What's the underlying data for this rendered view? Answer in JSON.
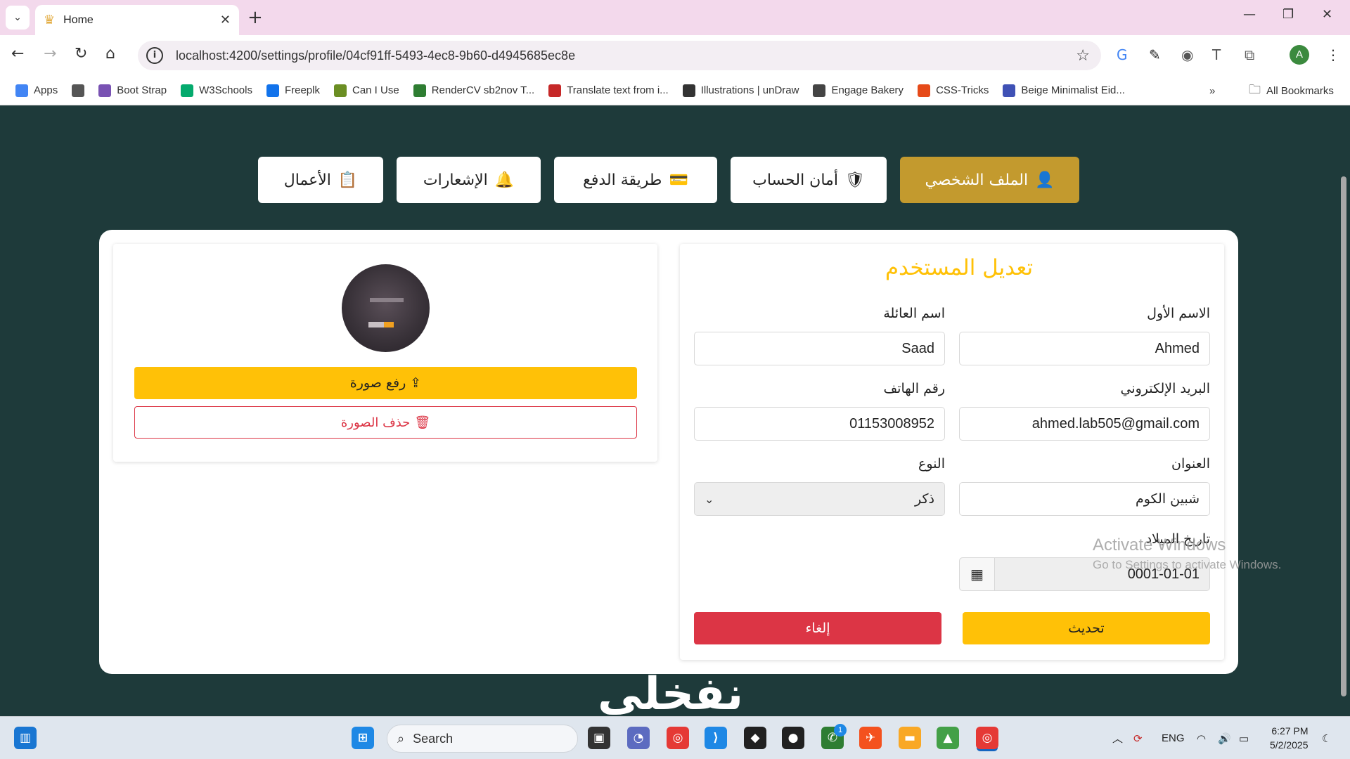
{
  "browser": {
    "tab_title": "Home",
    "url": "localhost:4200/settings/profile/04cf91ff-5493-4ec8-9b60-d4945685ec8e",
    "bookmarks": [
      {
        "label": "Apps",
        "icon": "apps-grid-icon",
        "color": "#4285f4"
      },
      {
        "label": "",
        "icon": "tab-groups-icon",
        "color": "#555555"
      },
      {
        "label": "Boot Strap",
        "icon": "bootstrap-icon",
        "color": "#7952b3"
      },
      {
        "label": "W3Schools",
        "icon": "w3schools-icon",
        "color": "#04aa6d"
      },
      {
        "label": "Freeplk",
        "icon": "freepik-icon",
        "color": "#1273eb"
      },
      {
        "label": "Can I Use",
        "icon": "caniuse-icon",
        "color": "#6b8e23"
      },
      {
        "label": "RenderCV sb2nov T...",
        "icon": "rendercv-icon",
        "color": "#2e7d32"
      },
      {
        "label": "Translate text from i...",
        "icon": "translate-icon",
        "color": "#c62828"
      },
      {
        "label": "Illustrations | unDraw",
        "icon": "undraw-icon",
        "color": "#333333"
      },
      {
        "label": "Engage Bakery",
        "icon": "globe-icon",
        "color": "#444444"
      },
      {
        "label": "CSS-Tricks",
        "icon": "csstricks-icon",
        "color": "#e64a19"
      },
      {
        "label": "Beige Minimalist Eid...",
        "icon": "canva-icon",
        "color": "#3f51b5"
      }
    ],
    "all_bookmarks": "All Bookmarks",
    "profile_initial": "A"
  },
  "settings_tabs": [
    {
      "label": "الملف الشخصي",
      "icon": "user-icon",
      "icon_glyph": "👤",
      "active": true
    },
    {
      "label": "أمان الحساب",
      "icon": "shield-icon",
      "icon_glyph": "🛡",
      "active": false
    },
    {
      "label": "طريقة الدفع",
      "icon": "credit-card-icon",
      "icon_glyph": "💳",
      "active": false
    },
    {
      "label": "الإشعارات",
      "icon": "bell-icon",
      "icon_glyph": "🔔",
      "active": false
    },
    {
      "label": "الأعمال",
      "icon": "clipboard-check-icon",
      "icon_glyph": "📋",
      "active": false
    }
  ],
  "profile_photo": {
    "upload_label": "رفع صورة",
    "delete_label": "حذف الصورة"
  },
  "form": {
    "title": "تعديل المستخدم",
    "first_name": {
      "label": "الاسم الأول",
      "value": "Ahmed"
    },
    "last_name": {
      "label": "اسم العائلة",
      "value": "Saad"
    },
    "email": {
      "label": "البريد الإلكتروني",
      "value": "ahmed.lab505@gmail.com"
    },
    "phone": {
      "label": "رقم الهاتف",
      "value": "01153008952"
    },
    "address": {
      "label": "العنوان",
      "value": "شبين الكوم"
    },
    "gender": {
      "label": "النوع",
      "value": "ذكر"
    },
    "birthdate": {
      "label": "تاريخ الميلاد",
      "value": "0001-01-01"
    },
    "update_label": "تحديث",
    "cancel_label": "إلغاء"
  },
  "watermark": {
    "line1": "Activate Windows",
    "line2": "Go to Settings to activate Windows."
  },
  "footer_logo": "نفخلي",
  "taskbar": {
    "search_placeholder": "Search",
    "language": "ENG",
    "time": "6:27 PM",
    "date": "5/2/2025",
    "whatsapp_badge": "1"
  },
  "colors": {
    "page_bg": "#1e3a3a",
    "accent_gold": "#c39a2e",
    "warning_yellow": "#ffc107",
    "danger_red": "#dc3545"
  }
}
